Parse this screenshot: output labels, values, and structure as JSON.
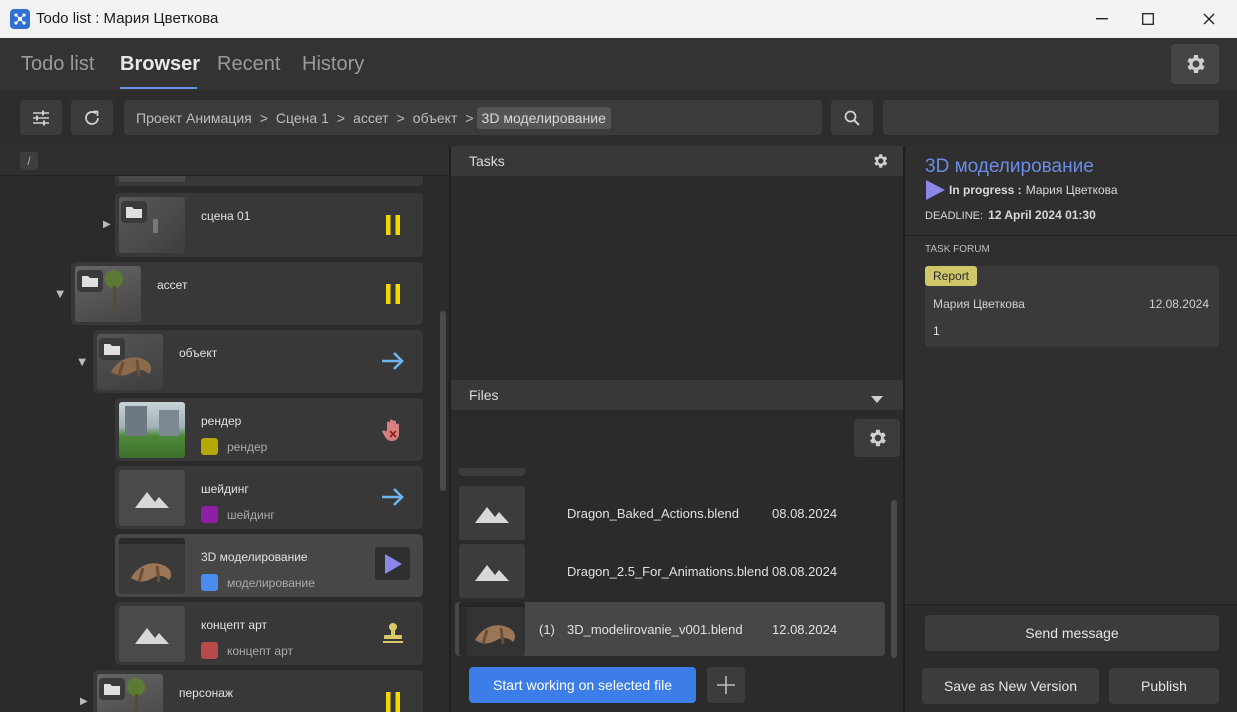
{
  "window": {
    "title": "Todo list : Мария Цветкова"
  },
  "nav": {
    "tabs": [
      {
        "label": "Todo list",
        "active": false
      },
      {
        "label": "Browser",
        "active": true
      },
      {
        "label": "Recent",
        "active": false
      },
      {
        "label": "History",
        "active": false
      }
    ]
  },
  "toolbar": {
    "breadcrumb": [
      "Проект Анимация",
      "Сцена 1",
      "ассет",
      "объект",
      "3D моделирование"
    ],
    "separator": ">",
    "search_value": ""
  },
  "tree": {
    "path_root": "/",
    "items": [
      {
        "name": "сцена 01",
        "status_icon": "pause-icon"
      },
      {
        "name": "ассет",
        "status_icon": "pause-icon"
      },
      {
        "name": "объект",
        "status_icon": "arrow-right-icon"
      },
      {
        "name": "рендер",
        "tag": "рендер",
        "tag_color": "#b5a800",
        "status_icon": "stop-hand-icon"
      },
      {
        "name": "шейдинг",
        "tag": "шейдинг",
        "tag_color": "#8e1fa6",
        "status_icon": "arrow-right-icon"
      },
      {
        "name": "3D моделирование",
        "tag": "моделирование",
        "tag_color": "#4a8cf0",
        "status_icon": "play-icon",
        "selected": true
      },
      {
        "name": "концепт арт",
        "tag": "концепт арт",
        "tag_color": "#b84a4a",
        "status_icon": "stamp-icon"
      },
      {
        "name": "персонаж",
        "status_icon": "pause-icon"
      }
    ]
  },
  "tasks": {
    "header": "Tasks"
  },
  "files": {
    "header": "Files",
    "rows": [
      {
        "version": "",
        "name": "Dragon_Baked_Actions.blend",
        "date": "08.08.2024"
      },
      {
        "version": "",
        "name": "Dragon_2.5_For_Animations.blend",
        "date": "08.08.2024"
      },
      {
        "version": "(1)",
        "name": "3D_modelirovanie_v001.blend",
        "date": "12.08.2024",
        "selected": true
      }
    ],
    "start_button": "Start working on selected file"
  },
  "task_detail": {
    "title": "3D моделирование",
    "status_label": "In progress :",
    "assignee": "Мария Цветкова",
    "deadline_label": "DEADLINE:",
    "deadline_value": "12 April 2024 01:30",
    "forum_label": "TASK FORUM",
    "message": {
      "badge": "Report",
      "author": "Мария Цветкова",
      "date": "12.08.2024",
      "body": "1"
    },
    "send_button": "Send message",
    "save_button": "Save as New Version",
    "publish_button": "Publish"
  },
  "colors": {
    "accent": "#3d7de8",
    "title_accent": "#6b8de8",
    "pause": "#f0d800",
    "arrow": "#6ab6ec",
    "play": "#8b86e8",
    "stop": "#e05a5a",
    "report": "#cfc769"
  }
}
